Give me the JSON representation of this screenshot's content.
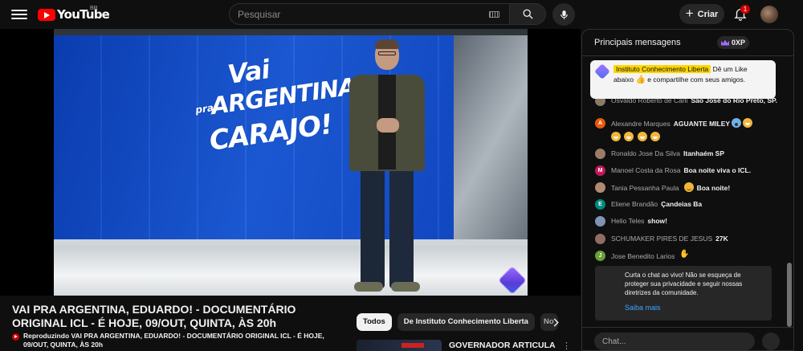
{
  "header": {
    "logo_text": "YouTube",
    "region": "BR",
    "search_placeholder": "Pesquisar",
    "create_label": "Criar",
    "notification_count": "1"
  },
  "video": {
    "art_line1": "Vai",
    "art_line2a": "pra",
    "art_line2b": "ARGENTINA,",
    "art_line3": "CARAJO!",
    "title": "VAI PRA ARGENTINA, EDUARDO! - DOCUMENTÁRIO ORIGINAL ICL - É HOJE, 09/OUT, QUINTA, ÀS 20h",
    "now_playing": "Reproduzindo VAI PRA ARGENTINA, EDUARDO! - DOCUMENTÁRIO ORIGINAL ICL - É HOJE, 09/OUT, QUINTA, ÀS 20h"
  },
  "chips": [
    "Todos",
    "De Instituto Conhecimento Liberta",
    "No"
  ],
  "recommendation": {
    "title": "GOVERNADOR ARTICULA"
  },
  "chat": {
    "header_title": "Principais mensagens",
    "points": "0XP",
    "pinned": {
      "author": "Instituto Conhecimento Liberta",
      "text_before": "Dê um Like abaixo",
      "text_after": "e compartilhe com seus amigos."
    },
    "messages": [
      {
        "author": "Osvaldo Roberto de Carli",
        "text": "São José do Rio Preto, SP.",
        "avatar_color": "#8a7a66",
        "avatar_letter": ""
      },
      {
        "author": "Alexandre Marques",
        "text": "AGUANTE MILEY",
        "avatar_color": "#e8590c",
        "avatar_letter": "A"
      },
      {
        "author": "Ronaldo Jose Da Silva",
        "text": "Itanhaém SP",
        "avatar_color": "#9c7b68",
        "avatar_letter": ""
      },
      {
        "author": "Manoel Costa da Rosa",
        "text": "Boa noite viva o ICL.",
        "avatar_color": "#c2185b",
        "avatar_letter": "M"
      },
      {
        "author": "Tania Pessanha Paula",
        "text": "Boa noite!",
        "avatar_color": "#b08a74",
        "avatar_letter": ""
      },
      {
        "author": "Eliene Brandão",
        "text": "Çandeias Ba",
        "avatar_color": "#00897b",
        "avatar_letter": "E"
      },
      {
        "author": "Helio Teles",
        "text": "show!",
        "avatar_color": "#7f93b3",
        "avatar_letter": ""
      },
      {
        "author": "SCHUMAKER PIRES DE JESUS",
        "text": "27K",
        "avatar_color": "#8e6e62",
        "avatar_letter": ""
      },
      {
        "author": "Jose Benedito Larios",
        "text": "",
        "avatar_color": "#689f38",
        "avatar_letter": "J"
      }
    ],
    "notice": {
      "text": "Curta o chat ao vivo! Não se esqueça de proteger sua privacidade e seguir nossas diretrizes da comunidade.",
      "link": "Saiba mais"
    },
    "input_placeholder": "Chat..."
  }
}
